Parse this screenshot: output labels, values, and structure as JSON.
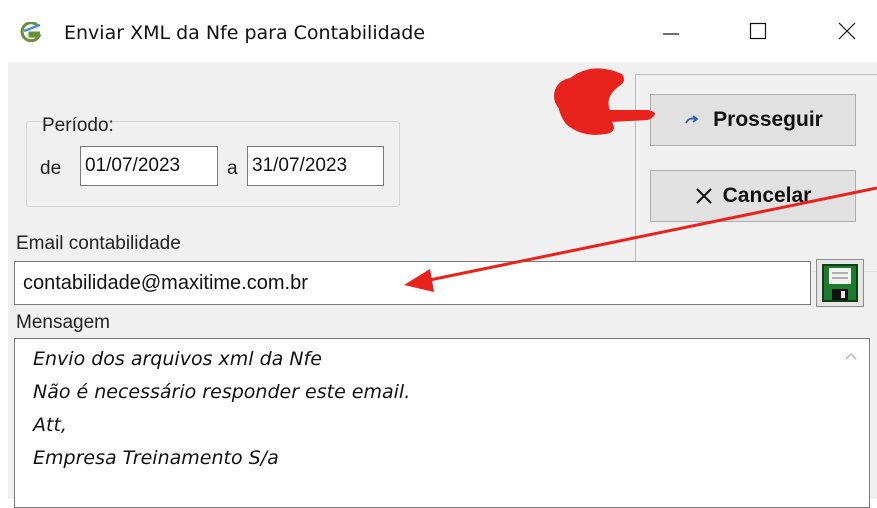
{
  "window": {
    "title": "Enviar XML da Nfe para Contabilidade",
    "icon": "app-logo-icon",
    "controls": [
      "minimize-icon",
      "maximize-icon",
      "close-icon"
    ]
  },
  "periodo": {
    "label": "Período:",
    "from_label": "de",
    "from_value": "01/07/2023",
    "to_label": "a",
    "to_value": "31/07/2023"
  },
  "buttons": {
    "proceed_label": "Prosseguir",
    "proceed_icon": "redo-arrow-icon",
    "cancel_label": "Cancelar",
    "cancel_icon": "x-icon"
  },
  "email": {
    "label": "Email contabilidade",
    "value": "contabilidade@maxitime.com.br",
    "save_icon": "floppy-disk-icon"
  },
  "message": {
    "label": "Mensagem",
    "lines": [
      "Envio dos arquivos xml da Nfe",
      "Não é necessário responder este email.",
      "Att,",
      "Empresa Treinamento S/a"
    ]
  },
  "annotations": {
    "pointer": "pointing-hand-icon",
    "arrow_color": "#e8221c"
  }
}
